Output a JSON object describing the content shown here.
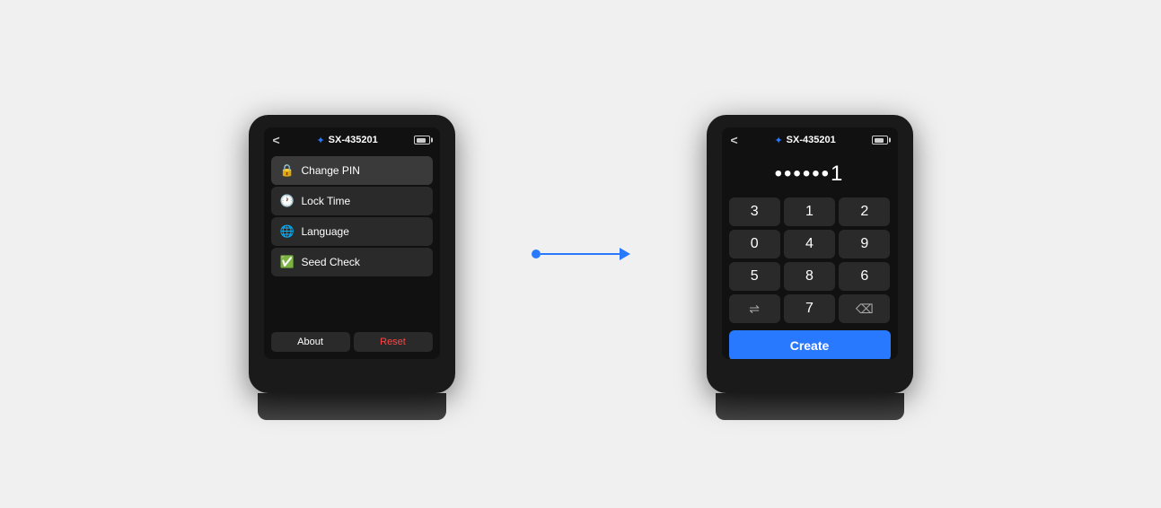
{
  "device1": {
    "header": {
      "back_label": "<",
      "device_name": "SX-435201"
    },
    "menu": {
      "items": [
        {
          "id": "change-pin",
          "icon": "🔒",
          "label": "Change PIN",
          "active": true
        },
        {
          "id": "lock-time",
          "icon": "🕐",
          "label": "Lock Time",
          "active": false
        },
        {
          "id": "language",
          "icon": "🌐",
          "label": "Language",
          "active": false
        },
        {
          "id": "seed-check",
          "icon": "✅",
          "label": "Seed Check",
          "active": false
        }
      ],
      "footer": {
        "about_label": "About",
        "reset_label": "Reset"
      }
    }
  },
  "device2": {
    "header": {
      "back_label": "<",
      "device_name": "SX-435201"
    },
    "pin_display": "••••••1",
    "numpad": {
      "rows": [
        [
          "3",
          "1",
          "2"
        ],
        [
          "0",
          "4",
          "9"
        ],
        [
          "5",
          "8",
          "6"
        ],
        [
          "⇌",
          "7",
          "⌫"
        ]
      ]
    },
    "create_button_label": "Create"
  },
  "arrow": {
    "color": "#2979ff"
  },
  "colors": {
    "accent_blue": "#2979ff",
    "screen_bg": "#111111",
    "device_bg": "#1a1a1a",
    "menu_item_bg": "#2a2a2a",
    "reset_red": "#ff4444",
    "text_white": "#ffffff"
  }
}
